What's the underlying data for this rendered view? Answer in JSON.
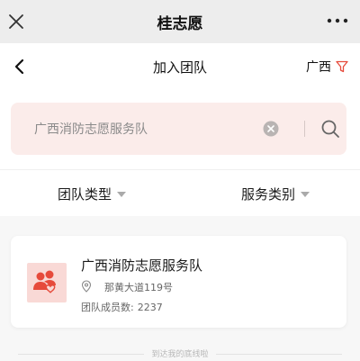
{
  "topbar": {
    "title": "桂志愿",
    "close_icon": "close-icon",
    "more_icon": "more-icon"
  },
  "navbar": {
    "title": "加入团队",
    "region": "广西",
    "back_icon": "chevron-left-icon",
    "filter_icon": "funnel-icon"
  },
  "search": {
    "placeholder": "广西消防志愿服务队",
    "clear_icon": "clear-icon",
    "search_icon": "search-icon"
  },
  "filters": {
    "team_type": "团队类型",
    "service_category": "服务类别"
  },
  "teams": [
    {
      "name": "广西消防志愿服务队",
      "address": "那黄大道119号",
      "members_label": "团队成员数:",
      "members_count": "2237"
    }
  ],
  "footer": {
    "end_text": "到达我的底线啦"
  },
  "colors": {
    "accent": "#e64a3b",
    "search_bg": "#fbecea",
    "avatar_bg": "#f9d9d6"
  }
}
